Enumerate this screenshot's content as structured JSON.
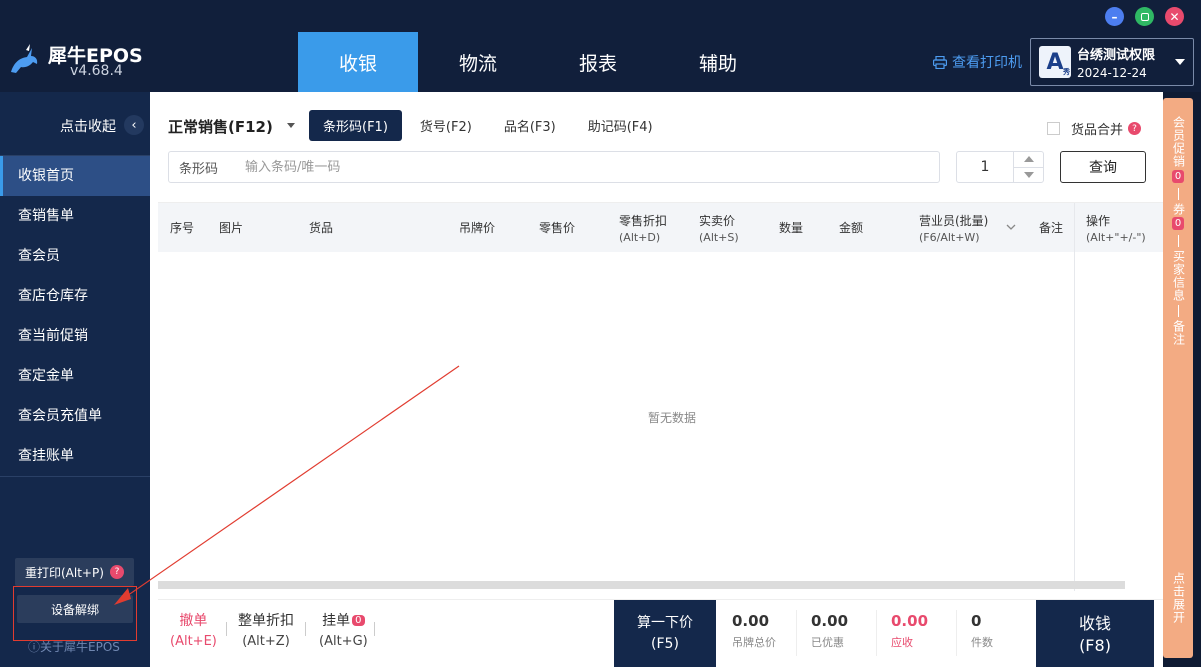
{
  "app": {
    "name": "犀牛EPOS",
    "version": "v4.68.4"
  },
  "window": {
    "minimize_color": "#4d7ef0",
    "maximize_color": "#2fb864",
    "close_color": "#e84a6d"
  },
  "nav": {
    "tabs": [
      {
        "label": "收银",
        "active": true
      },
      {
        "label": "物流",
        "active": false
      },
      {
        "label": "报表",
        "active": false
      },
      {
        "label": "辅助",
        "active": false
      }
    ]
  },
  "header": {
    "printer_label": "查看打印机",
    "user": {
      "avatar_letter": "A",
      "avatar_sub": "秀",
      "name": "台绣测试权限",
      "date": "2024-12-24"
    }
  },
  "sidebar": {
    "collapse_label": "点击收起",
    "collapse_glyph": "‹",
    "items": [
      {
        "label": "收银首页",
        "active": true
      },
      {
        "label": "查销售单",
        "active": false
      },
      {
        "label": "查会员",
        "active": false
      },
      {
        "label": "查店仓库存",
        "active": false
      },
      {
        "label": "查当前促销",
        "active": false
      },
      {
        "label": "查定金单",
        "active": false
      },
      {
        "label": "查会员充值单",
        "active": false
      },
      {
        "label": "查挂账单",
        "active": false
      }
    ],
    "reprint_label": "重打印(Alt+P)",
    "reprint_help": "?",
    "unbind_label": "设备解绑",
    "about_label": "ⓘ关于犀牛EPOS"
  },
  "sales": {
    "mode_label": "正常销售(F12)",
    "search_tabs": [
      {
        "label": "条形码(F1)",
        "active": true
      },
      {
        "label": "货号(F2)",
        "active": false
      },
      {
        "label": "品名(F3)",
        "active": false
      },
      {
        "label": "助记码(F4)",
        "active": false
      }
    ],
    "merge_label": "货品合并",
    "merge_help": "?",
    "barcode_label": "条形码",
    "barcode_placeholder": "输入条码/唯一码",
    "qty_value": "1",
    "query_label": "查询"
  },
  "table": {
    "columns": [
      {
        "label": "序号",
        "sub": ""
      },
      {
        "label": "图片",
        "sub": ""
      },
      {
        "label": "货品",
        "sub": ""
      },
      {
        "label": "吊牌价",
        "sub": ""
      },
      {
        "label": "零售价",
        "sub": ""
      },
      {
        "label": "零售折扣",
        "sub": "(Alt+D)"
      },
      {
        "label": "实卖价",
        "sub": "(Alt+S)"
      },
      {
        "label": "数量",
        "sub": ""
      },
      {
        "label": "金额",
        "sub": ""
      },
      {
        "label": "营业员(批量)",
        "sub": "(F6/Alt+W)"
      },
      {
        "label": "备注",
        "sub": ""
      },
      {
        "label": "操作",
        "sub": "(Alt+\"+/-\")"
      }
    ],
    "empty_text": "暂无数据"
  },
  "bottom": {
    "cancel": {
      "label": "撤单",
      "key": "(Alt+E)"
    },
    "discount": {
      "label": "整单折扣",
      "key": "(Alt+Z)"
    },
    "hang": {
      "label": "挂单",
      "badge": "0",
      "key": "(Alt+G)"
    },
    "calc": {
      "label": "算一下价",
      "key": "(F5)"
    },
    "stats": [
      {
        "value": "0.00",
        "label": "吊牌总价",
        "highlight": false
      },
      {
        "value": "0.00",
        "label": "已优惠",
        "highlight": false
      },
      {
        "value": "0.00",
        "label": "应收",
        "highlight": true
      },
      {
        "value": "0",
        "label": "件数",
        "highlight": false
      }
    ],
    "pay": {
      "label": "收钱",
      "key": "(F8)"
    }
  },
  "right_strip": {
    "member_promo": "会员促销",
    "member_promo_count": "0",
    "coupon": "券",
    "coupon_count": "0",
    "buyer_info": "买家信息",
    "remark": "备注",
    "expand": "点击展开"
  },
  "colors": {
    "accent": "#3a9bea",
    "dark": "#14284b",
    "warn": "#e84a6d",
    "strip": "#f3ab83"
  }
}
